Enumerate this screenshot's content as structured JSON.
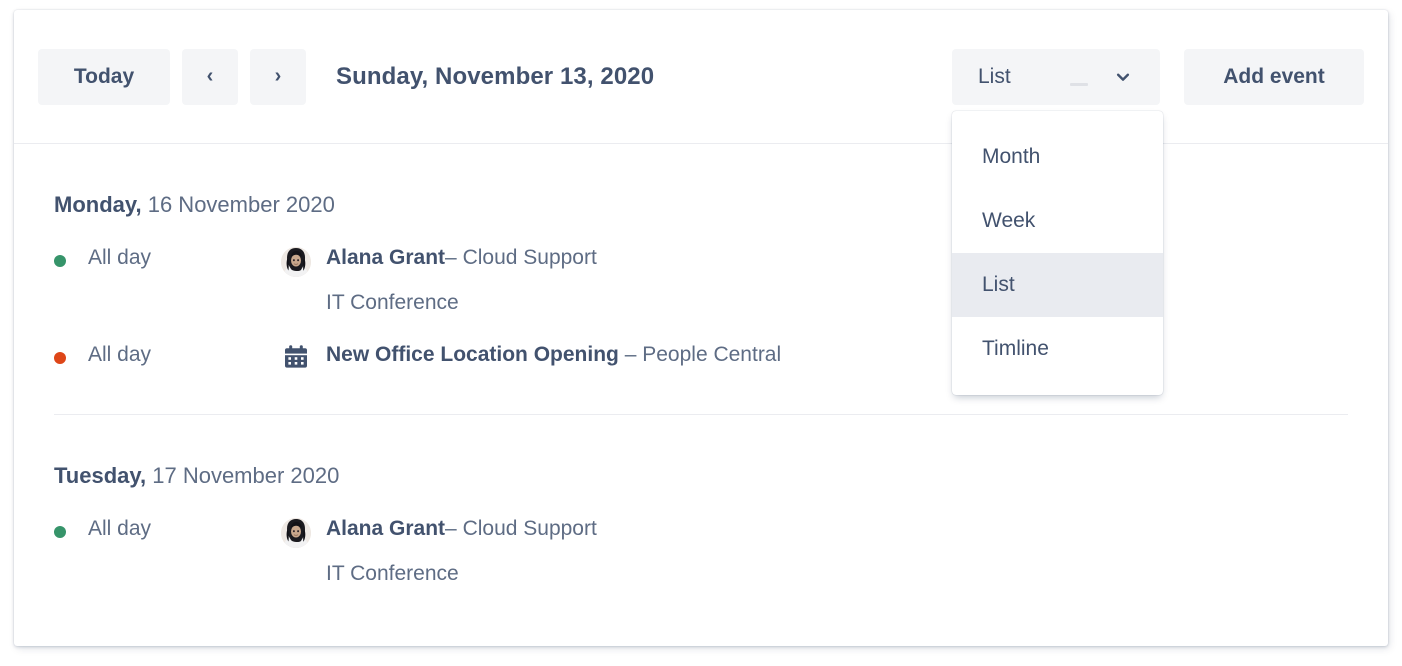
{
  "toolbar": {
    "today_label": "Today",
    "prev_label": "‹",
    "next_label": "›",
    "title": "Sunday, November 13, 2020",
    "view_select_value": "List",
    "add_event_label": "Add event"
  },
  "view_dropdown": {
    "open": true,
    "selected": "List",
    "options": [
      {
        "label": "Month"
      },
      {
        "label": "Week"
      },
      {
        "label": "List"
      },
      {
        "label": "Timline"
      }
    ]
  },
  "colors": {
    "dot_green": "#36946A",
    "dot_red": "#DE4618",
    "text_dark": "#42526E",
    "text_muted": "#5E6C84",
    "button_bg": "#F4F5F7",
    "divider": "#EBECF0",
    "menu_selected_bg": "#E9EBF0"
  },
  "agenda": {
    "groups": [
      {
        "weekday": "Monday,",
        "date": "16 November 2020",
        "events": [
          {
            "dot_color": "#36946A",
            "time": "All day",
            "icon": "avatar-icon",
            "title": "Alana Grant",
            "separator": "–",
            "subject": "Cloud Support",
            "subtitle": "IT Conference"
          },
          {
            "dot_color": "#DE4618",
            "time": "All day",
            "icon": "calendar-icon",
            "title": "New Office Location Opening",
            "separator": "–",
            "subject": "People Central",
            "subtitle": ""
          }
        ]
      },
      {
        "weekday": "Tuesday,",
        "date": "17 November 2020",
        "events": [
          {
            "dot_color": "#36946A",
            "time": "All day",
            "icon": "avatar-icon",
            "title": "Alana Grant",
            "separator": "–",
            "subject": "Cloud Support",
            "subtitle": "IT Conference"
          }
        ]
      }
    ]
  }
}
